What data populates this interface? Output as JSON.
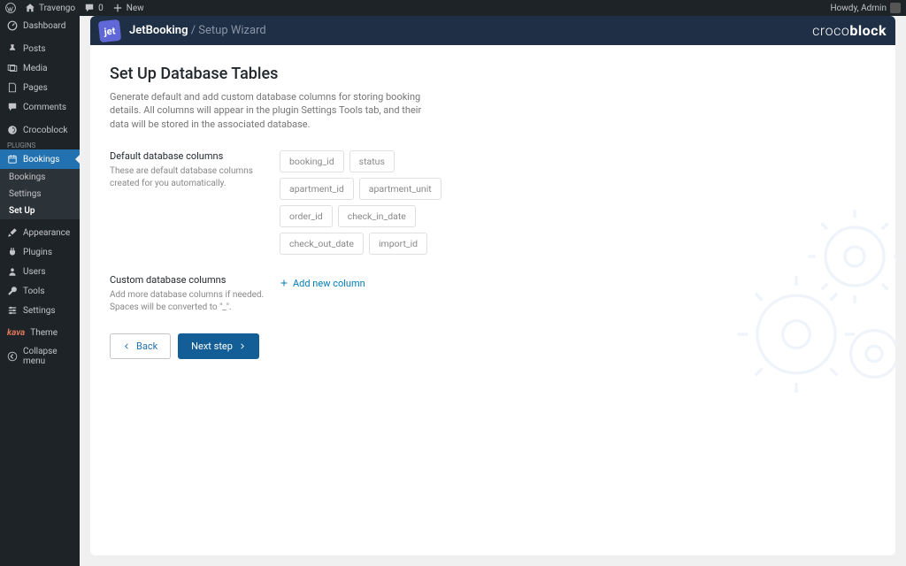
{
  "adminbar": {
    "site": "Travengo",
    "comments": "0",
    "new": "New",
    "howdy": "Howdy, Admin"
  },
  "sidebar": {
    "pluginsLabel": "PLUGINS",
    "items": [
      {
        "label": "Dashboard"
      },
      {
        "label": "Posts"
      },
      {
        "label": "Media"
      },
      {
        "label": "Pages"
      },
      {
        "label": "Comments"
      },
      {
        "label": "Crocoblock"
      },
      {
        "label": "Bookings"
      },
      {
        "label": "Appearance"
      },
      {
        "label": "Plugins"
      },
      {
        "label": "Users"
      },
      {
        "label": "Tools"
      },
      {
        "label": "Settings"
      },
      {
        "label": "Theme"
      },
      {
        "label": "Collapse menu"
      }
    ],
    "sub": {
      "bookings": "Bookings",
      "settings": "Settings",
      "setup": "Set Up"
    }
  },
  "header": {
    "badge": "jet",
    "title": "JetBooking",
    "sub": "/ Setup Wizard",
    "logo1": "croco",
    "logo2": "block"
  },
  "content": {
    "h1": "Set Up Database Tables",
    "desc": "Generate default and add custom database columns for storing booking details. All columns will appear in the plugin Settings Tools tab, and their data will be stored in the associated database.",
    "defaultCols": {
      "title": "Default database columns",
      "desc": "These are default database columns created for you automatically.",
      "tags": [
        "booking_id",
        "status",
        "apartment_id",
        "apartment_unit",
        "order_id",
        "check_in_date",
        "check_out_date",
        "import_id"
      ]
    },
    "customCols": {
      "title": "Custom database columns",
      "desc": "Add more database columns if needed. Spaces will be converted to \"_\".",
      "add": "Add new column"
    },
    "actions": {
      "back": "Back",
      "next": "Next step"
    }
  }
}
